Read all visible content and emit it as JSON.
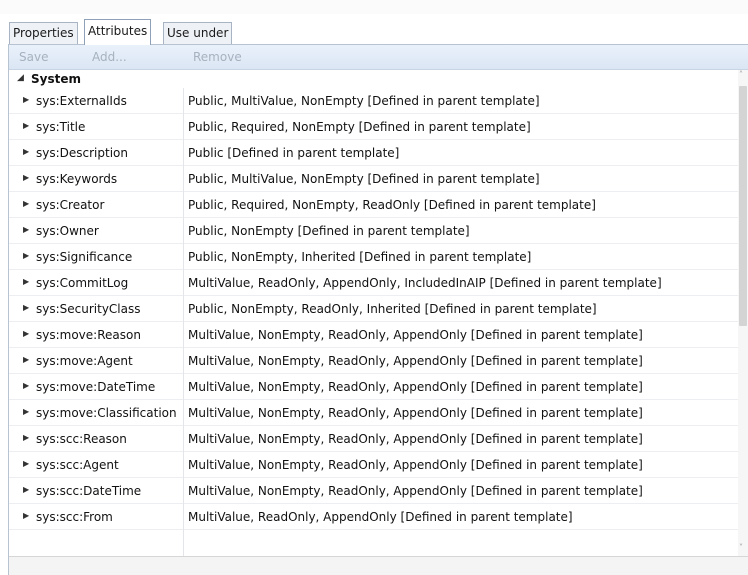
{
  "tabs": [
    {
      "label": "Properties",
      "active": false
    },
    {
      "label": "Attributes",
      "active": true
    },
    {
      "label": "Use under",
      "active": false
    }
  ],
  "toolbar": {
    "save_label": "Save",
    "add_label": "Add...",
    "remove_label": "Remove"
  },
  "group": {
    "title": "System",
    "collapse_icon": "triangle-down-icon"
  },
  "attributes": [
    {
      "name": "sys:ExternalIds",
      "description": "Public, MultiValue, NonEmpty  [Defined in parent template]"
    },
    {
      "name": "sys:Title",
      "description": "Public, Required, NonEmpty  [Defined in parent template]"
    },
    {
      "name": "sys:Description",
      "description": "Public  [Defined in parent template]"
    },
    {
      "name": "sys:Keywords",
      "description": "Public, MultiValue, NonEmpty  [Defined in parent template]"
    },
    {
      "name": "sys:Creator",
      "description": "Public, Required, NonEmpty, ReadOnly  [Defined in parent template]"
    },
    {
      "name": "sys:Owner",
      "description": "Public, NonEmpty  [Defined in parent template]"
    },
    {
      "name": "sys:Significance",
      "description": "Public, NonEmpty, Inherited  [Defined in parent template]"
    },
    {
      "name": "sys:CommitLog",
      "description": "MultiValue, ReadOnly, AppendOnly, IncludedInAIP  [Defined in parent template]"
    },
    {
      "name": "sys:SecurityClass",
      "description": "Public, NonEmpty, ReadOnly, Inherited  [Defined in parent template]"
    },
    {
      "name": "sys:move:Reason",
      "description": "MultiValue, NonEmpty, ReadOnly, AppendOnly  [Defined in parent template]"
    },
    {
      "name": "sys:move:Agent",
      "description": "MultiValue, NonEmpty, ReadOnly, AppendOnly  [Defined in parent template]"
    },
    {
      "name": "sys:move:DateTime",
      "description": "MultiValue, NonEmpty, ReadOnly, AppendOnly  [Defined in parent template]"
    },
    {
      "name": "sys:move:Classification",
      "description": "MultiValue, NonEmpty, ReadOnly, AppendOnly  [Defined in parent template]"
    },
    {
      "name": "sys:scc:Reason",
      "description": "MultiValue, NonEmpty, ReadOnly, AppendOnly  [Defined in parent template]"
    },
    {
      "name": "sys:scc:Agent",
      "description": "MultiValue, NonEmpty, ReadOnly, AppendOnly  [Defined in parent template]"
    },
    {
      "name": "sys:scc:DateTime",
      "description": "MultiValue, NonEmpty, ReadOnly, AppendOnly  [Defined in parent template]"
    },
    {
      "name": "sys:scc:From",
      "description": "MultiValue, ReadOnly, AppendOnly  [Defined in parent template]"
    }
  ],
  "colors": {
    "toolbar_bg": "#dbe6f4",
    "disabled_text": "#a6b1bf",
    "tab_border": "#a8b4c4"
  }
}
